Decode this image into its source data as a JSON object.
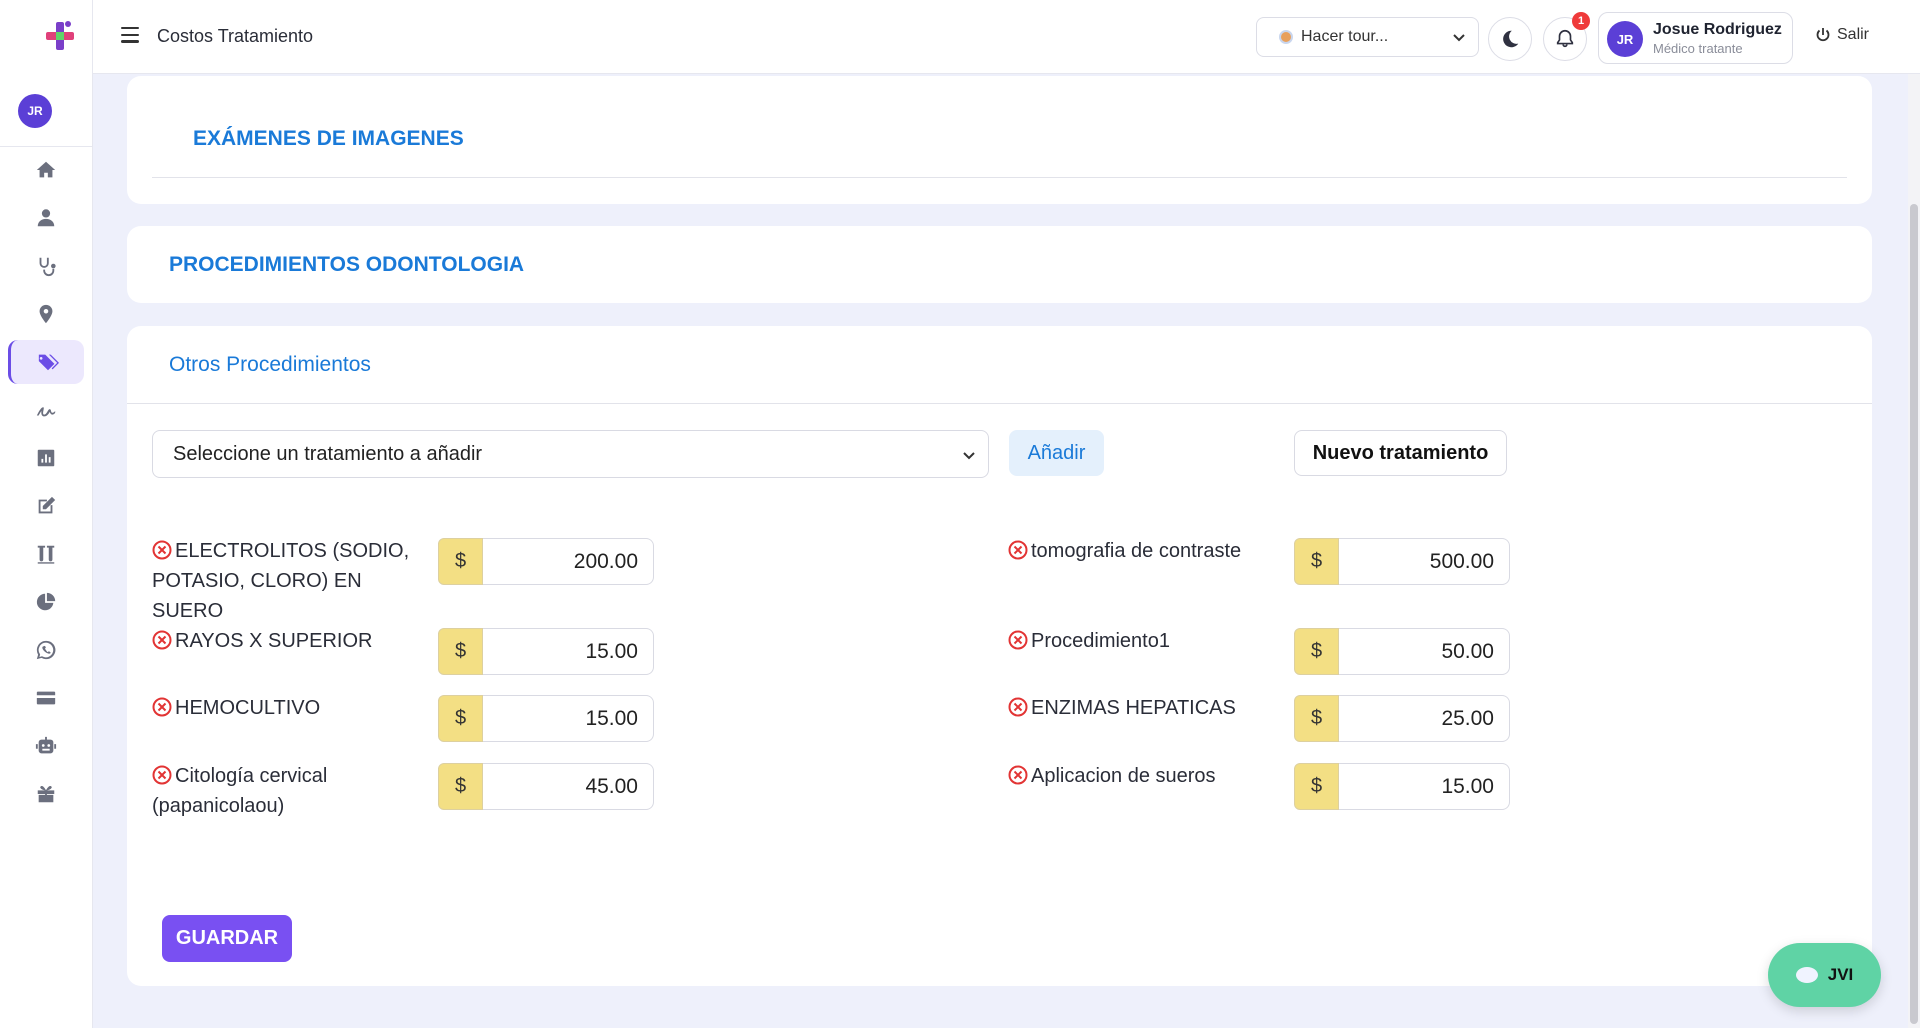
{
  "app": {
    "page_title": "Costos Tratamiento"
  },
  "sidebar": {
    "avatar_initials": "JR",
    "items": [
      {
        "icon": "home-icon"
      },
      {
        "icon": "user-icon"
      },
      {
        "icon": "stethoscope-icon"
      },
      {
        "icon": "location-pin-icon"
      },
      {
        "icon": "tags-icon",
        "active": true
      },
      {
        "icon": "signature-icon"
      },
      {
        "icon": "bar-chart-icon"
      },
      {
        "icon": "edit-icon"
      },
      {
        "icon": "test-tubes-icon"
      },
      {
        "icon": "pie-chart-icon"
      },
      {
        "icon": "whatsapp-icon"
      },
      {
        "icon": "credit-card-icon"
      },
      {
        "icon": "robot-icon"
      },
      {
        "icon": "gift-icon"
      }
    ]
  },
  "topbar": {
    "tour_select_value": "Hacer tour...",
    "notification_count": "1",
    "user_initials": "JR",
    "user_name": "Josue Rodriguez",
    "user_role": "Médico tratante",
    "logout_label": "Salir"
  },
  "sections": {
    "imaging_title": "EXÁMENES DE IMAGENES",
    "dental_title": "PROCEDIMIENTOS ODONTOLOGIA",
    "other_title": "Otros Procedimientos"
  },
  "form": {
    "treatment_select_value": "Seleccione un tratamiento a añadir",
    "add_label": "Añadir",
    "new_label": "Nuevo tratamiento",
    "currency": "$",
    "save_label": "GUARDAR"
  },
  "items_left": [
    {
      "name": "ELECTROLITOS (SODIO, POTASIO, CLORO) EN SUERO",
      "price": "200.00"
    },
    {
      "name": "RAYOS X SUPERIOR",
      "price": "15.00"
    },
    {
      "name": "HEMOCULTIVO",
      "price": "15.00"
    },
    {
      "name": "Citología cervical (papanicolaou)",
      "price": "45.00"
    }
  ],
  "items_right": [
    {
      "name": "tomografia de contraste",
      "price": "500.00"
    },
    {
      "name": "Procedimiento1",
      "price": "50.00"
    },
    {
      "name": "ENZIMAS HEPATICAS",
      "price": "25.00"
    },
    {
      "name": "Aplicacion de sueros",
      "price": "15.00"
    }
  ],
  "chat": {
    "label": "JVI"
  },
  "colors": {
    "accent": "#7950f2",
    "link_blue": "#1a7ad8",
    "currency_bg": "#f3df84",
    "chat_green": "#5fd3a5"
  }
}
